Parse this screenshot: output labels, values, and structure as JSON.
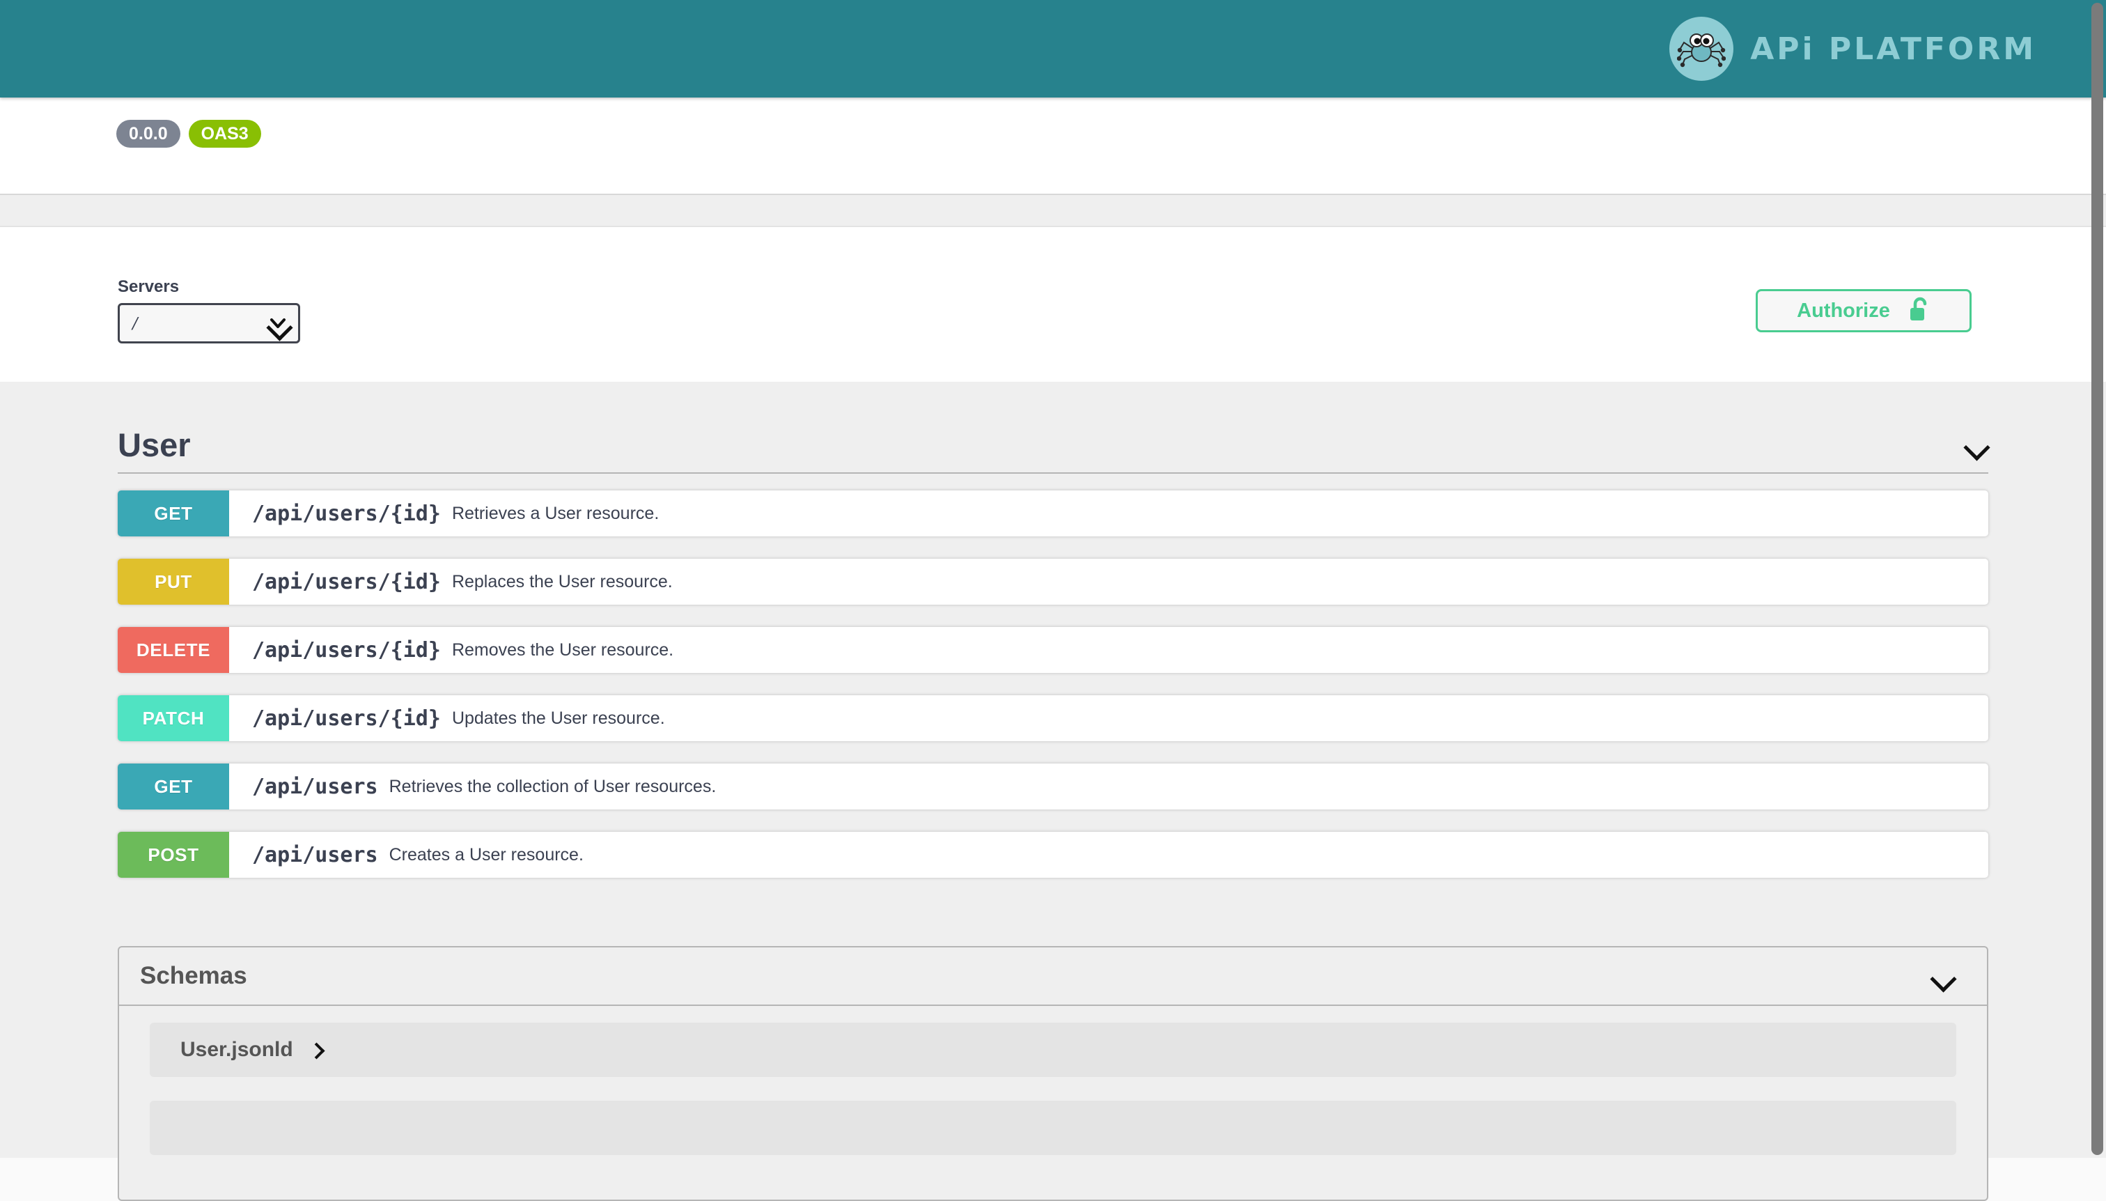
{
  "brand": {
    "name": "APi PLATFORM",
    "logo_icon": "spider-logo-icon",
    "bar_color": "#27828d",
    "text_color": "#8ecdd4"
  },
  "info": {
    "version_badge": "0.0.0",
    "spec_badge": "OAS3",
    "version_badge_color": "#7d8492",
    "spec_badge_color": "#89bf04"
  },
  "servers": {
    "label": "Servers",
    "selected": "/",
    "options": [
      "/"
    ],
    "dropdown_icon": "chevron-down-icon"
  },
  "authorize": {
    "label": "Authorize",
    "lock_icon": "unlocked-padlock-icon",
    "accent_color": "#49cc90"
  },
  "tag": {
    "title": "User",
    "toggle_icon": "chevron-down-icon",
    "expanded": true,
    "operations": [
      {
        "method": "GET",
        "path": "/api/users/{id}",
        "summary": "Retrieves a User resource.",
        "color": "#3aa8b5"
      },
      {
        "method": "PUT",
        "path": "/api/users/{id}",
        "summary": "Replaces the User resource.",
        "color": "#e0c02c"
      },
      {
        "method": "DELETE",
        "path": "/api/users/{id}",
        "summary": "Removes the User resource.",
        "color": "#ef6a5f"
      },
      {
        "method": "PATCH",
        "path": "/api/users/{id}",
        "summary": "Updates the User resource.",
        "color": "#50e3c2"
      },
      {
        "method": "GET",
        "path": "/api/users",
        "summary": "Retrieves the collection of User resources.",
        "color": "#3aa8b5"
      },
      {
        "method": "POST",
        "path": "/api/users",
        "summary": "Creates a User resource.",
        "color": "#6cbb5a"
      }
    ]
  },
  "schemas": {
    "title": "Schemas",
    "toggle_icon": "chevron-down-icon",
    "expanded": true,
    "models": [
      {
        "name": "User.jsonld",
        "toggle_icon": "chevron-right-icon"
      },
      {
        "name": "",
        "toggle_icon": "chevron-right-icon"
      }
    ]
  },
  "scrollbar": {
    "orientation": "vertical",
    "position": "top"
  }
}
